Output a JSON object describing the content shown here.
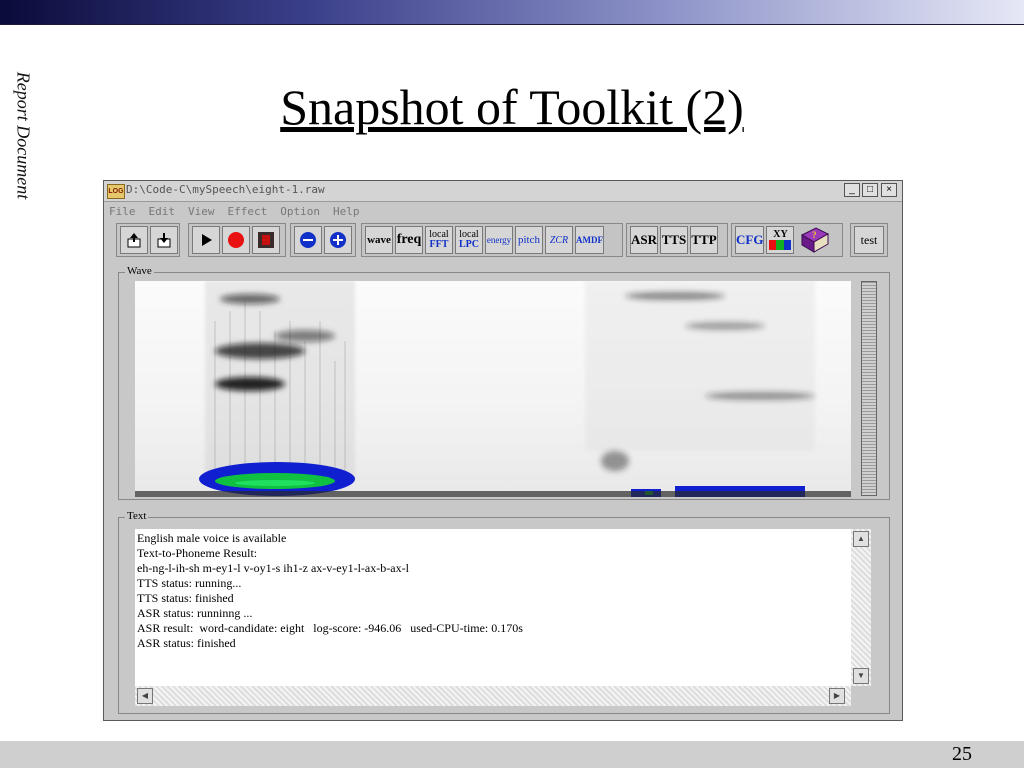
{
  "slide": {
    "side_label": "Report Document",
    "title": "Snapshot of Toolkit (2)",
    "page_number": "25"
  },
  "window": {
    "title": "D:\\Code-C\\mySpeech\\eight-1.raw",
    "app_icon_label": "LOG",
    "controls": [
      "_",
      "□",
      "×"
    ]
  },
  "menu": [
    "File",
    "Edit",
    "View",
    "Effect",
    "Option",
    "Help"
  ],
  "toolbar": {
    "wave": "wave",
    "freq": "freq",
    "local_fft_top": "local",
    "local_fft_bottom": "FFT",
    "local_lpc_top": "local",
    "local_lpc_bottom": "LPC",
    "energy": "energy",
    "pitch": "pitch",
    "zcr": "ZCR",
    "amdf": "AMDF",
    "asr": "ASR",
    "tts": "TTS",
    "ttp": "TTP",
    "cfg": "CFG",
    "xy": "XY",
    "test": "test"
  },
  "panels": {
    "wave_label": "Wave",
    "text_label": "Text"
  },
  "log": [
    "English male voice is available",
    "",
    "Text-to-Phoneme Result:",
    "eh-ng-l-ih-sh m-ey1-l v-oy1-s ih1-z ax-v-ey1-l-ax-b-ax-l",
    "TTS status: running...",
    "TTS status: finished",
    "ASR status: runninng ...",
    "ASR result:  word-candidate: eight   log-score: -946.06   used-CPU-time: 0.170s",
    "ASR status: finished"
  ],
  "colors": {
    "record": "#e81010",
    "stop": "#c81010",
    "zoom": "#1030c8",
    "spectro_energy": "#1020d0",
    "spectro_peak": "#10c040"
  }
}
